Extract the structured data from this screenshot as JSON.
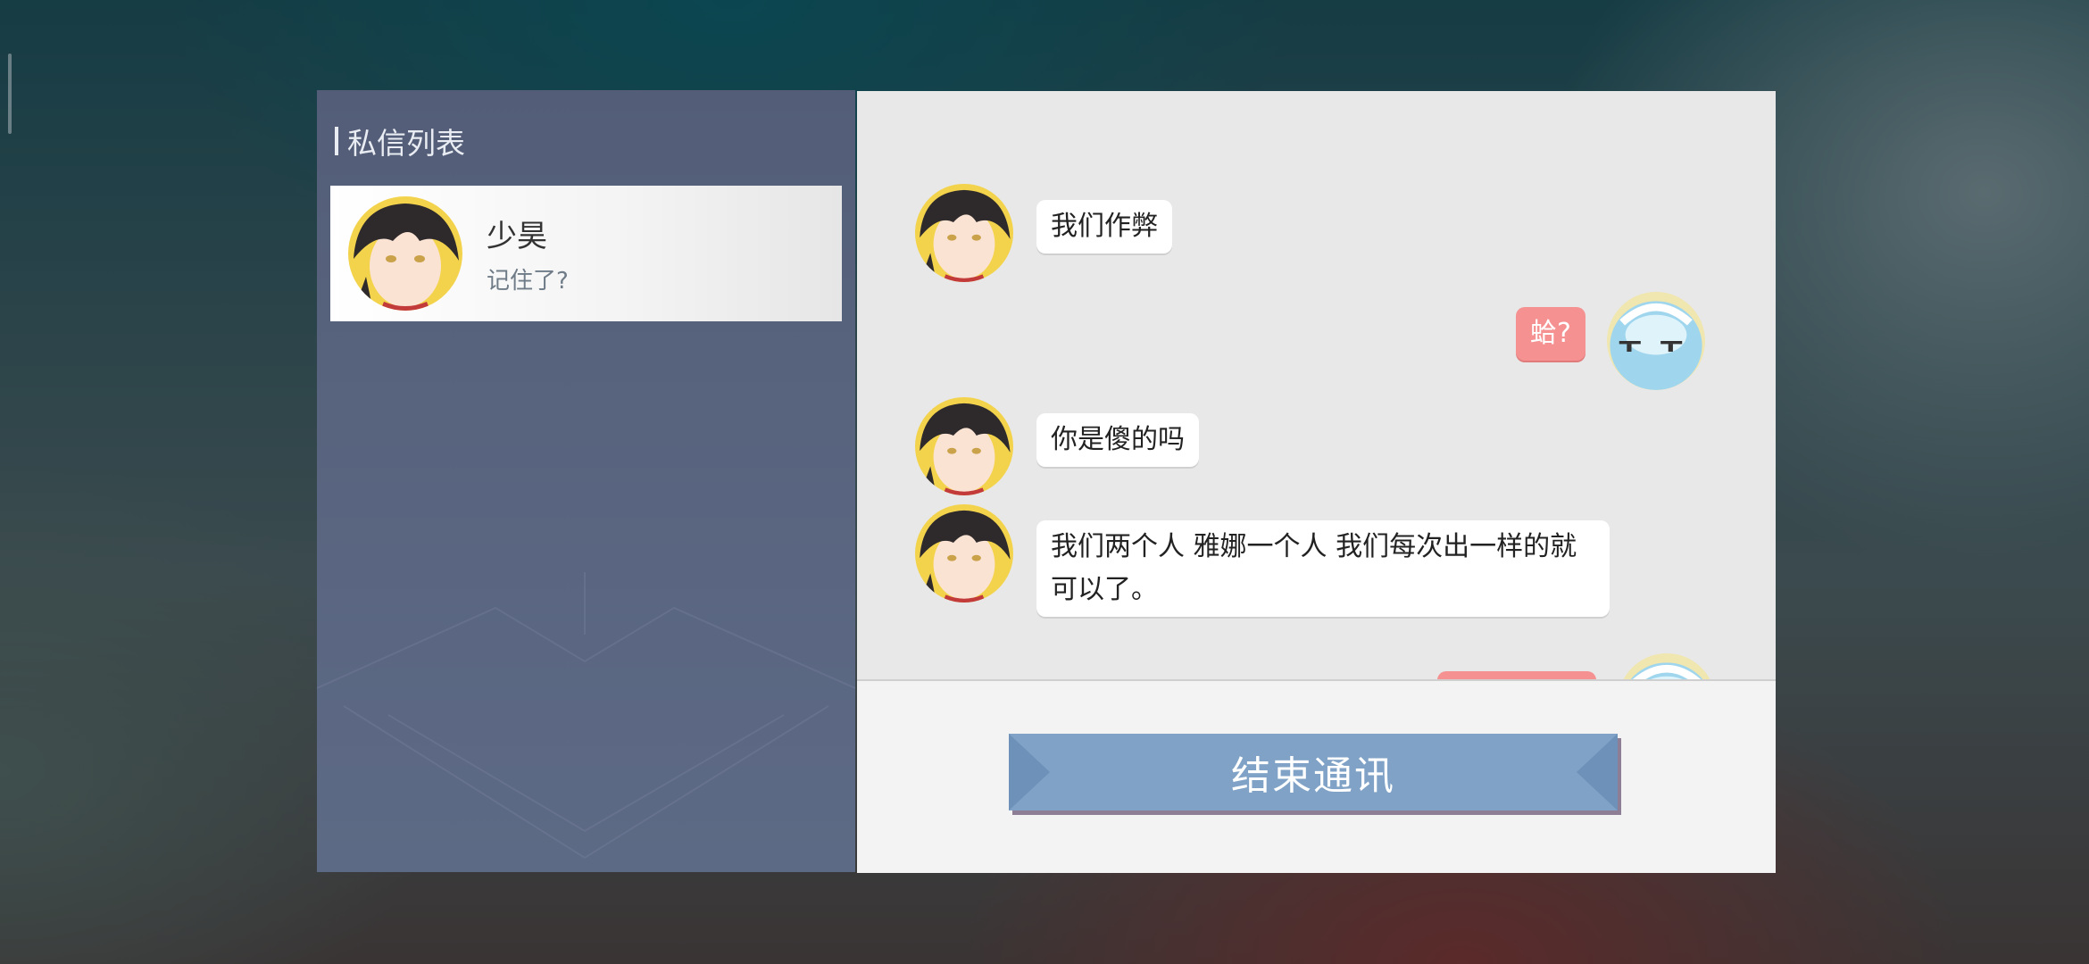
{
  "sidebar": {
    "title": "私信列表",
    "contacts": [
      {
        "name": "少昊",
        "preview": "记住了?"
      }
    ]
  },
  "chat": {
    "messages": [
      {
        "sender": "contact",
        "text": "我们作弊"
      },
      {
        "sender": "me",
        "text": "蛤?"
      },
      {
        "sender": "contact",
        "text": "你是傻的吗"
      },
      {
        "sender": "contact",
        "lines": [
          "我们两个人 雅娜一个人 我们每次出一样的就",
          "可以了。"
        ]
      },
      {
        "sender": "me",
        "text": ""
      }
    ],
    "end_button": "结束通讯"
  },
  "colors": {
    "accent_button": "#7fa2c6",
    "my_bubble": "#f59191",
    "sidebar_bg": "#56627c"
  }
}
